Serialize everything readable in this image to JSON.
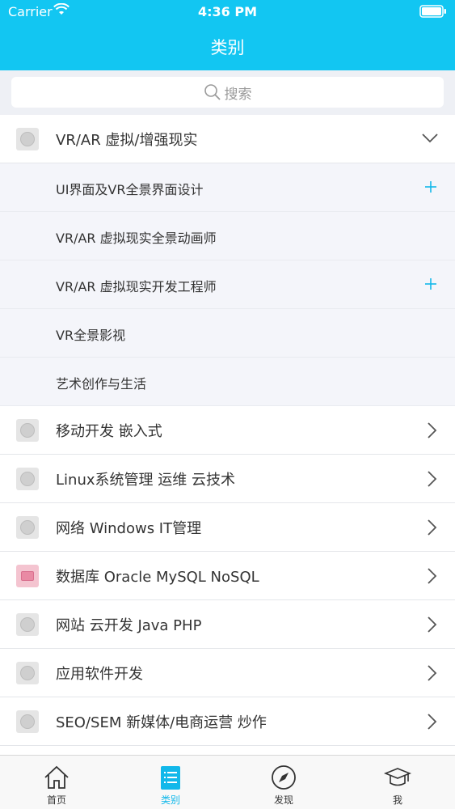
{
  "status": {
    "carrier": "Carrier",
    "time": "4:36 PM"
  },
  "nav": {
    "title": "类别"
  },
  "search": {
    "placeholder": "搜索"
  },
  "expanded": {
    "label": "VR/AR 虚拟/增强现实",
    "subitems": [
      {
        "label": "UI界面及VR全景界面设计",
        "has_plus": true
      },
      {
        "label": "VR/AR 虚拟现实全景动画师",
        "has_plus": false
      },
      {
        "label": "VR/AR 虚拟现实开发工程师",
        "has_plus": true
      },
      {
        "label": "VR全景影视",
        "has_plus": false
      },
      {
        "label": "艺术创作与生活",
        "has_plus": false
      }
    ]
  },
  "categories": [
    {
      "label": "移动开发 嵌入式"
    },
    {
      "label": "Linux系统管理 运维 云技术"
    },
    {
      "label": "网络 Windows IT管理"
    },
    {
      "label": "数据库 Oracle MySQL NoSQL"
    },
    {
      "label": "网站 云开发 Java PHP"
    },
    {
      "label": "应用软件开发"
    },
    {
      "label": "SEO/SEM 新媒体/电商运营 炒作"
    }
  ],
  "tabs": [
    {
      "label": "首页",
      "icon": "home-icon"
    },
    {
      "label": "类别",
      "icon": "list-icon"
    },
    {
      "label": "发现",
      "icon": "compass-icon"
    },
    {
      "label": "我",
      "icon": "graduation-cap-icon"
    }
  ],
  "colors": {
    "accent": "#12c6f2",
    "tab_active": "#12b8ea",
    "sub_bg": "#f4f5fa"
  }
}
